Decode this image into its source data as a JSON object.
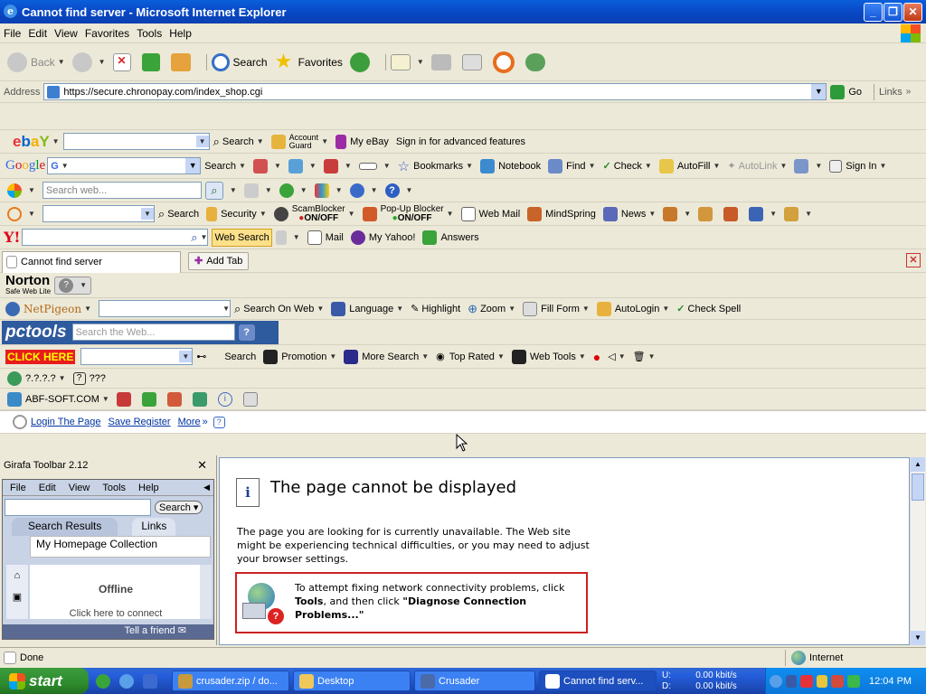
{
  "window": {
    "title": "Cannot find server - Microsoft Internet Explorer"
  },
  "menu": [
    "File",
    "Edit",
    "View",
    "Favorites",
    "Tools",
    "Help"
  ],
  "toolbar": {
    "back": "Back",
    "search": "Search",
    "favorites": "Favorites"
  },
  "address": {
    "label": "Address",
    "url": "https://secure.chronopay.com/index_shop.cgi",
    "go": "Go",
    "links": "Links"
  },
  "ebay": {
    "search": "Search",
    "account_guard_1": "Account",
    "account_guard_2": "Guard",
    "my_ebay": "My eBay",
    "sign_in": "Sign in for advanced features"
  },
  "google": {
    "search": "Search",
    "bookmarks": "Bookmarks",
    "notebook": "Notebook",
    "find": "Find",
    "check": "Check",
    "autofill": "AutoFill",
    "autolink": "AutoLink",
    "sign_in": "Sign In"
  },
  "msn": {
    "placeholder": "Search web..."
  },
  "earthlink": {
    "search": "Search",
    "security": "Security",
    "scamblocker": "ScamBlocker",
    "scam_state": "ON/OFF",
    "popup": "Pop-Up Blocker",
    "popup_state": "ON/OFF",
    "webmail": "Web Mail",
    "mindspring": "MindSpring",
    "news": "News"
  },
  "yahoo": {
    "web_search": "Web Search",
    "mail": "Mail",
    "my_yahoo": "My Yahoo!",
    "answers": "Answers"
  },
  "tabs": {
    "current": "Cannot find server",
    "add_tab": "Add Tab"
  },
  "norton": {
    "brand": "Norton",
    "sub": "Safe Web Lite"
  },
  "netpigeon": {
    "brand": "NetPigeon",
    "search_on_web": "Search On Web",
    "language": "Language",
    "highlight": "Highlight",
    "zoom": "Zoom",
    "fill_form": "Fill Form",
    "autologin": "AutoLogin",
    "check_spell": "Check Spell"
  },
  "pctools": {
    "brand": "pctools",
    "placeholder": "Search the Web..."
  },
  "clickhere": {
    "brand": "CLICK HERE",
    "search": "Search",
    "promotion": "Promotion",
    "more_search": "More Search",
    "top_rated": "Top Rated",
    "web_tools": "Web Tools"
  },
  "unknown_bar": {
    "left": "?.?.?.?",
    "right": "???"
  },
  "abf": {
    "name": "ABF-SOFT.COM"
  },
  "login_bar": {
    "login": "Login The Page",
    "save": "Save Register",
    "more": "More"
  },
  "girafa": {
    "title": "Girafa Toolbar 2.12",
    "menu": [
      "File",
      "Edit",
      "View",
      "Tools",
      "Help"
    ],
    "search_btn": "Search",
    "tab_results": "Search Results",
    "tab_links": "Links",
    "homepage": "My Homepage Collection",
    "offline": "Offline",
    "connect": "Click here to connect",
    "tell": "Tell a friend"
  },
  "error": {
    "heading": "The page cannot be displayed",
    "body": "The page you are looking for is currently unavailable. The Web site might be experiencing technical difficulties, or you may need to adjust your browser settings.",
    "tip_1": "To attempt fixing network connectivity problems, click ",
    "tip_tools": "Tools",
    "tip_2": ", and then click ",
    "tip_diag": "\"Diagnose Connection Problems...\""
  },
  "status": {
    "text": "Done",
    "zone": "Internet"
  },
  "taskbar": {
    "start": "start",
    "tasks": [
      "crusader.zip / do...",
      "Desktop",
      "Crusader",
      "Cannot find serv..."
    ],
    "net_u_label": "U:",
    "net_u": "0.00 kbit/s",
    "net_d_label": "D:",
    "net_d": "0.00 kbit/s",
    "clock": "12:04 PM"
  },
  "colors": {
    "xp_blue": "#0a5fdb",
    "error_border": "#cc2222",
    "start_green": "#2e8b2e"
  }
}
